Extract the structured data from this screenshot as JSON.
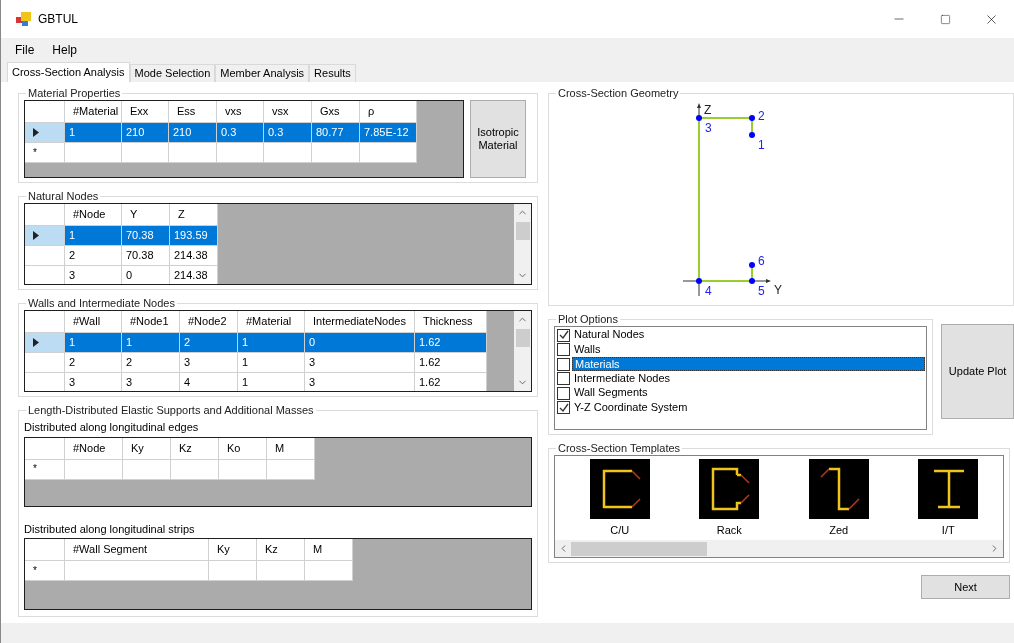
{
  "window": {
    "title": "GBTUL"
  },
  "menu": [
    "File",
    "Help"
  ],
  "tabs": [
    {
      "label": "Cross-Section Analysis",
      "selected": true
    },
    {
      "label": "Mode Selection",
      "selected": false
    },
    {
      "label": "Member Analysis",
      "selected": false
    },
    {
      "label": "Results",
      "selected": false
    }
  ],
  "material_properties": {
    "title": "Material Properties",
    "table": {
      "columns": [
        "#Material",
        "Exx",
        "Ess",
        "vxs",
        "vsx",
        "Gxs",
        "ρ"
      ],
      "rows": [
        {
          "cells": [
            "1",
            "210",
            "210",
            "0.3",
            "0.3",
            "80.77",
            "7.85E-12"
          ],
          "selected": true
        }
      ],
      "new_row_marker": "*"
    },
    "button": "Isotropic Material"
  },
  "natural_nodes": {
    "title": "Natural Nodes",
    "table": {
      "columns": [
        "#Node",
        "Y",
        "Z"
      ],
      "rows": [
        {
          "cells": [
            "1",
            "70.38",
            "193.59"
          ],
          "selected": true
        },
        {
          "cells": [
            "2",
            "70.38",
            "214.38"
          ],
          "selected": false
        },
        {
          "cells": [
            "3",
            "0",
            "214.38"
          ],
          "selected": false
        }
      ]
    }
  },
  "walls": {
    "title": "Walls and Intermediate Nodes",
    "table": {
      "columns": [
        "#Wall",
        "#Node1",
        "#Node2",
        "#Material",
        "IntermediateNodes",
        "Thickness"
      ],
      "rows": [
        {
          "cells": [
            "1",
            "1",
            "2",
            "1",
            "0",
            "1.62"
          ],
          "selected": true
        },
        {
          "cells": [
            "2",
            "2",
            "3",
            "1",
            "3",
            "1.62"
          ],
          "selected": false
        },
        {
          "cells": [
            "3",
            "3",
            "4",
            "1",
            "3",
            "1.62"
          ],
          "selected": false
        }
      ]
    }
  },
  "supports": {
    "title": "Length-Distributed Elastic Supports and Additional Masses",
    "edges": {
      "title": "Distributed along longitudinal edges",
      "table": {
        "columns": [
          "#Node",
          "Ky",
          "Kz",
          "Ko",
          "M"
        ],
        "new_row_marker": "*"
      }
    },
    "strips": {
      "title": "Distributed along longitudinal strips",
      "table": {
        "columns": [
          "#Wall Segment",
          "Ky",
          "Kz",
          "M"
        ],
        "new_row_marker": "*"
      }
    }
  },
  "geometry": {
    "title": "Cross-Section Geometry",
    "node_labels": [
      "2",
      "3",
      "1",
      "6",
      "4",
      "5"
    ],
    "axis_labels": [
      "Z",
      "Y"
    ]
  },
  "plot_options": {
    "title": "Plot Options",
    "items": [
      {
        "label": "Natural Nodes",
        "checked": true,
        "selected": false
      },
      {
        "label": "Walls",
        "checked": false,
        "selected": false
      },
      {
        "label": "Materials",
        "checked": false,
        "selected": true
      },
      {
        "label": "Intermediate Nodes",
        "checked": false,
        "selected": false
      },
      {
        "label": "Wall Segments",
        "checked": false,
        "selected": false
      },
      {
        "label": "Y-Z Coordinate System",
        "checked": true,
        "selected": false
      }
    ],
    "button": "Update Plot"
  },
  "templates": {
    "title": "Cross-Section Templates",
    "items": [
      {
        "label": "C/U",
        "kind": "channel"
      },
      {
        "label": "Rack",
        "kind": "rack"
      },
      {
        "label": "Zed",
        "kind": "zed"
      },
      {
        "label": "I/T",
        "kind": "ibeam"
      }
    ]
  },
  "next_button": "Next"
}
